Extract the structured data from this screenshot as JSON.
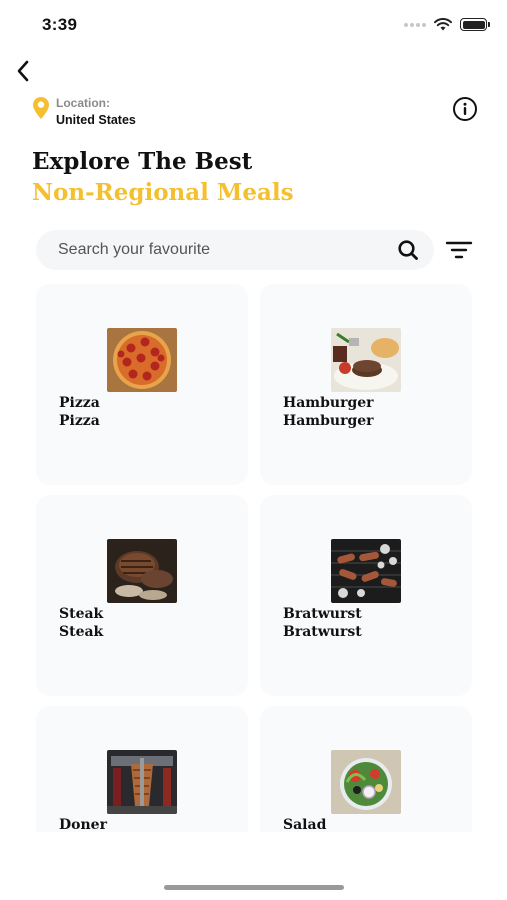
{
  "status": {
    "time": "3:39"
  },
  "location": {
    "label": "Location:",
    "value": "United States"
  },
  "headline": {
    "line1": "Explore The Best",
    "line2": "Non-Regional Meals"
  },
  "search": {
    "placeholder": "Search your favourite"
  },
  "meals": [
    {
      "name": "Pizza",
      "subtitle": "Pizza",
      "icon": "pizza-photo"
    },
    {
      "name": "Hamburger",
      "subtitle": "Hamburger",
      "icon": "hamburger-photo"
    },
    {
      "name": "Steak",
      "subtitle": "Steak",
      "icon": "steak-photo"
    },
    {
      "name": "Bratwurst",
      "subtitle": "Bratwurst",
      "icon": "bratwurst-photo"
    },
    {
      "name": "Doner",
      "subtitle": "",
      "icon": "doner-photo"
    },
    {
      "name": "Salad",
      "subtitle": "",
      "icon": "salad-photo"
    }
  ],
  "colors": {
    "accent": "#f5c02f",
    "card_bg": "#f8fafc",
    "search_bg": "#f4f6f8"
  }
}
